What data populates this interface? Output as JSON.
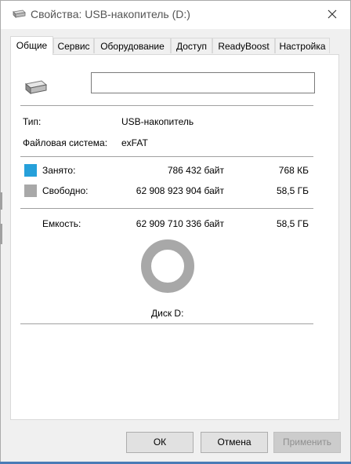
{
  "window": {
    "title": "Свойства: USB-накопитель (D:)"
  },
  "tabs": [
    {
      "label": "Общие"
    },
    {
      "label": "Сервис"
    },
    {
      "label": "Оборудование"
    },
    {
      "label": "Доступ"
    },
    {
      "label": "ReadyBoost"
    },
    {
      "label": "Настройка"
    }
  ],
  "general": {
    "volume_name": "",
    "type_label": "Тип:",
    "type_value": "USB-накопитель",
    "fs_label": "Файловая система:",
    "fs_value": "exFAT",
    "used_label": "Занято:",
    "used_bytes": "786 432 байт",
    "used_short": "768 КБ",
    "used_color": "#26a0da",
    "free_label": "Свободно:",
    "free_bytes": "62 908 923 904 байт",
    "free_short": "58,5 ГБ",
    "free_color": "#a8a8a8",
    "capacity_label": "Емкость:",
    "capacity_bytes": "62 909 710 336 байт",
    "capacity_short": "58,5 ГБ",
    "disk_label": "Диск D:"
  },
  "buttons": {
    "ok": "ОК",
    "cancel": "Отмена",
    "apply": "Применить"
  }
}
